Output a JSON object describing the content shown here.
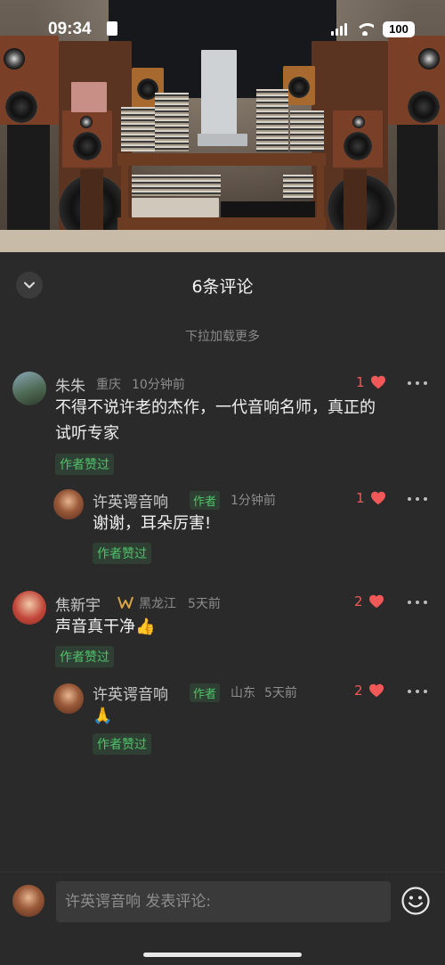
{
  "status_bar": {
    "time": "09:34",
    "battery": "100"
  },
  "sheet": {
    "title": "6条评论",
    "load_more": "下拉加载更多"
  },
  "comments": [
    {
      "name": "朱朱",
      "location": "重庆",
      "time": "10分钟前",
      "text_line1": "不得不说许老的杰作，一代音响名师，真正的",
      "text_line2": "试听专家",
      "liked_tag": "作者赞过",
      "likes": "1",
      "reply": {
        "name": "许英谔音响",
        "author_tag": "作者",
        "time": "1分钟前",
        "text": "谢谢，耳朵厉害!",
        "liked_tag": "作者赞过",
        "likes": "1"
      }
    },
    {
      "name": "焦新宇",
      "location": "黑龙江",
      "time": "5天前",
      "text": "声音真干净👍",
      "liked_tag": "作者赞过",
      "likes": "2",
      "reply": {
        "name": "许英谔音响",
        "author_tag": "作者",
        "location": "山东",
        "time": "5天前",
        "text": "🙏",
        "liked_tag": "作者赞过",
        "likes": "2"
      }
    }
  ],
  "input": {
    "placeholder": "许英谔音响 发表评论:"
  },
  "colors": {
    "background": "#2a2a2a",
    "like_red": "#f15858",
    "author_green": "#4fc36a"
  }
}
